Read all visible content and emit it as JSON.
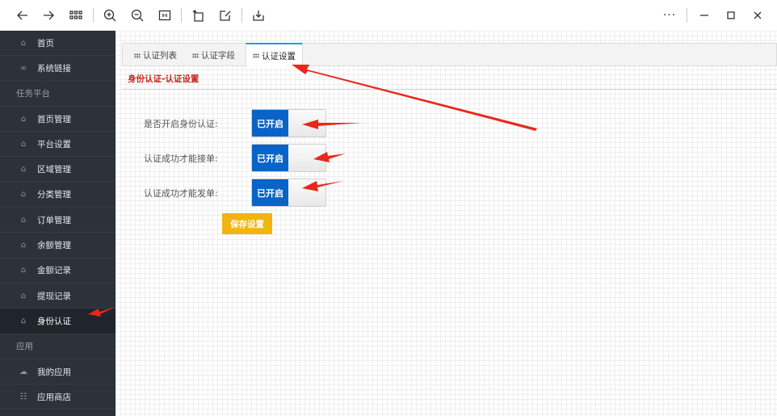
{
  "toolbar": {
    "icons": [
      "back-arrow-icon",
      "forward-arrow-icon",
      "grid-apps-icon",
      "zoom-in-icon",
      "zoom-out-icon",
      "fit-page-icon",
      "rotate-icon",
      "edit-icon",
      "download-icon"
    ],
    "more_label": "···",
    "window_controls": [
      "minimize-icon",
      "maximize-icon",
      "close-icon"
    ]
  },
  "sidebar": {
    "top_items": [
      {
        "label": "首页",
        "icon": "home-icon"
      },
      {
        "label": "系统链接",
        "icon": "link-icon"
      }
    ],
    "group_task": "任务平台",
    "task_items": [
      {
        "label": "首页管理",
        "icon": "home-icon"
      },
      {
        "label": "平台设置",
        "icon": "home-icon"
      },
      {
        "label": "区域管理",
        "icon": "home-icon"
      },
      {
        "label": "分类管理",
        "icon": "home-icon"
      },
      {
        "label": "订单管理",
        "icon": "home-icon"
      },
      {
        "label": "余额管理",
        "icon": "home-icon"
      },
      {
        "label": "金额记录",
        "icon": "home-icon"
      },
      {
        "label": "提现记录",
        "icon": "home-icon"
      },
      {
        "label": "身份认证",
        "icon": "home-icon",
        "active": true
      }
    ],
    "group_app": "应用",
    "app_items": [
      {
        "label": "我的应用",
        "icon": "cloud-icon"
      },
      {
        "label": "应用商店",
        "icon": "store-icon"
      }
    ]
  },
  "tabs": [
    {
      "label": "认证列表",
      "active": false
    },
    {
      "label": "认证字段",
      "active": false
    },
    {
      "label": "认证设置",
      "active": true
    }
  ],
  "subtitle": "身份认证-认证设置",
  "settings": [
    {
      "label": "是否开启身份认证:",
      "toggle": "已开启",
      "on": true
    },
    {
      "label": "认证成功才能接单:",
      "toggle": "已开启",
      "on": true
    },
    {
      "label": "认证成功才能发单:",
      "toggle": "已开启",
      "on": true
    }
  ],
  "save_label": "保存设置",
  "colors": {
    "sidebar_bg": "#2b323a",
    "toggle_on": "#0a63c7",
    "save_button": "#f1b410",
    "subtitle_red": "#c8251c",
    "tab_active_border": "#1b9de0",
    "annotation_arrow": "#e8281c"
  }
}
